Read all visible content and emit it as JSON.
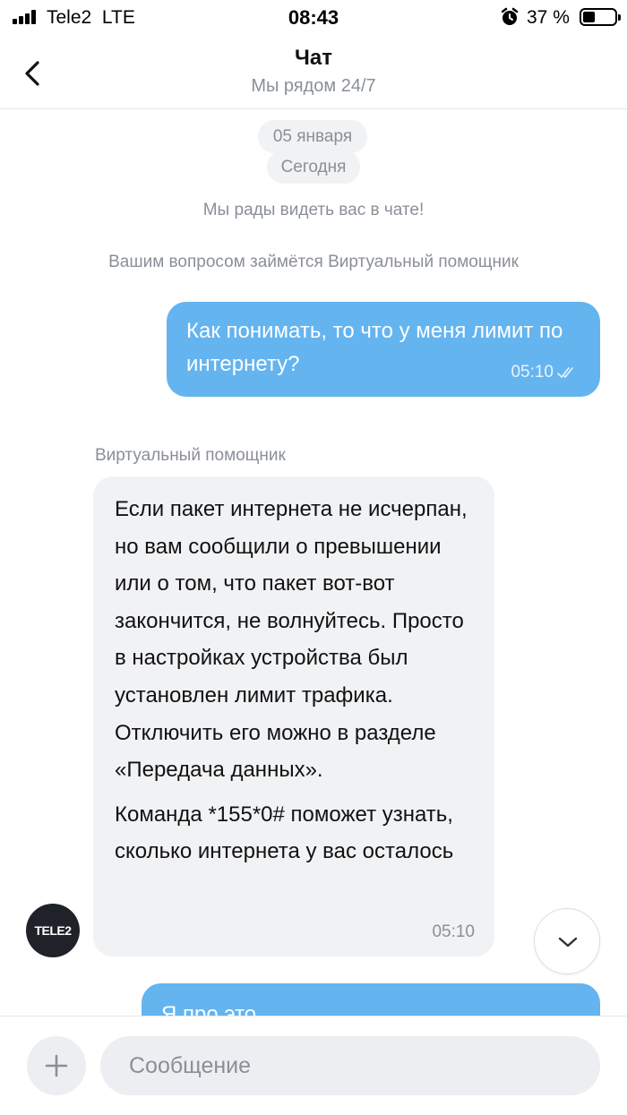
{
  "status_bar": {
    "carrier": "Tele2",
    "network": "LTE",
    "time": "08:43",
    "battery_percent": "37 %",
    "icons": [
      "signal-icon",
      "alarm-icon",
      "battery-icon"
    ]
  },
  "header": {
    "title": "Чат",
    "subtitle": "Мы рядом 24/7",
    "back_icon": "chevron-left-icon"
  },
  "chat": {
    "date": "05 января",
    "today_label": "Сегодня",
    "system_messages": [
      "Мы рады видеть вас в чате!",
      "Вашим вопросом займётся Виртуальный помощник"
    ],
    "messages": [
      {
        "direction": "outgoing",
        "text": "Как понимать, то что у меня лимит по интернету?",
        "time": "05:10",
        "status": "read-checkmark-icon"
      },
      {
        "direction": "incoming",
        "sender": "Виртуальный помощник",
        "avatar_label": "TELE2",
        "paragraphs": [
          "Если пакет интернета не исчерпан, но вам сообщили о превышении или о том, что пакет вот-вот закончится, не волнуйтесь. Просто в настройках устройства был установлен лимит трафика. Отключить его можно в разделе «Передача данных».",
          "Команда *155*0# поможет узнать, сколько интернета у вас осталось"
        ],
        "time": "05:10"
      },
      {
        "direction": "outgoing",
        "text": "Я про это",
        "partially_visible": true
      }
    ]
  },
  "composer": {
    "placeholder": "Сообщение",
    "attach_icon": "plus-icon",
    "scroll_down_icon": "chevron-down-icon"
  },
  "colors": {
    "outgoing_bubble": "#64b4f0",
    "incoming_bubble": "#f1f2f4",
    "secondary_text": "#8a8f98"
  }
}
